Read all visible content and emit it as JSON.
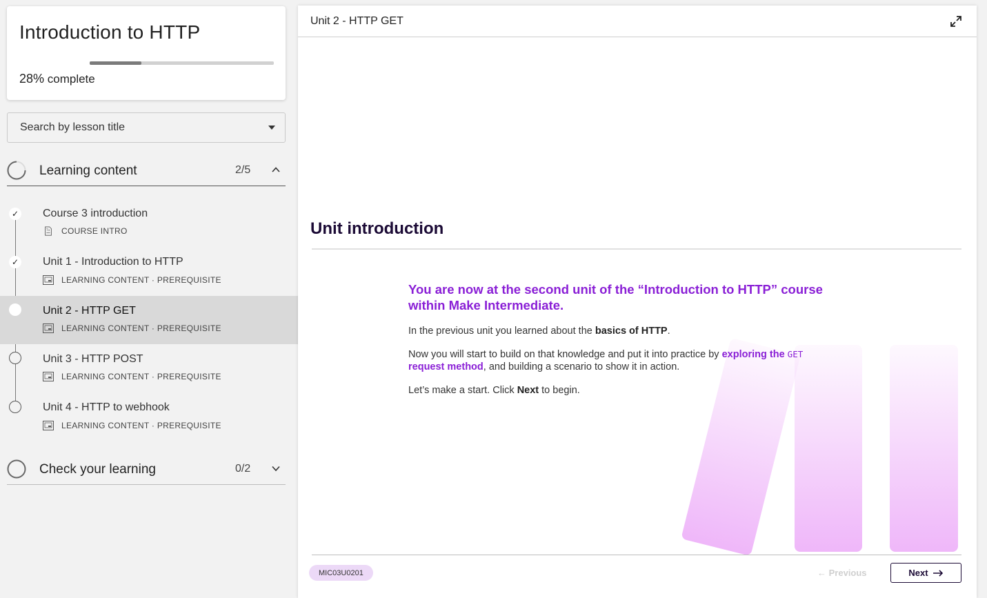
{
  "course": {
    "title": "Introduction to HTTP",
    "progress_percent": 28,
    "progress_value": "28%",
    "progress_suffix": " complete"
  },
  "search": {
    "placeholder": "Search by lesson title"
  },
  "sections": [
    {
      "title": "Learning content",
      "count": "2/5",
      "expanded": true,
      "lessons": [
        {
          "title": "Course 3 introduction",
          "meta": "COURSE INTRO",
          "status": "done",
          "icon": "document-icon"
        },
        {
          "title": "Unit 1 - Introduction to HTTP",
          "meta": "LEARNING CONTENT · PREREQUISITE",
          "status": "done",
          "icon": "slides-icon"
        },
        {
          "title": "Unit 2 - HTTP GET",
          "meta": "LEARNING CONTENT · PREREQUISITE",
          "status": "current",
          "icon": "slides-icon"
        },
        {
          "title": "Unit 3 - HTTP POST",
          "meta": "LEARNING CONTENT · PREREQUISITE",
          "status": "open",
          "icon": "slides-icon"
        },
        {
          "title": "Unit 4 - HTTP to webhook",
          "meta": "LEARNING CONTENT · PREREQUISITE",
          "status": "open",
          "icon": "slides-icon"
        }
      ]
    },
    {
      "title": "Check your learning",
      "count": "0/2",
      "expanded": false
    }
  ],
  "main": {
    "header_title": "Unit 2 - HTTP GET",
    "heading": "Unit introduction",
    "lead": "You are now at the second unit of the “Introduction to HTTP” course within Make Intermediate.",
    "p1_before": "In the previous unit you learned about the ",
    "p1_strong": "basics of HTTP",
    "p1_after": ".",
    "p2_before": "Now you will start to build on that knowledge and put it into practice by ",
    "p2_em1": "exploring the ",
    "p2_code": "GET",
    "p2_em2": "request method",
    "p2_after": ", and building a scenario to show it in action.",
    "p3_before": "Let’s make a start. Click ",
    "p3_strong": "Next",
    "p3_after": " to begin.",
    "badge": "MIC03U0201",
    "prev_label": "Previous",
    "next_label": "Next"
  },
  "colors": {
    "accent": "#8a1fd6",
    "brand_dark": "#1b0a35",
    "badge_bg": "#ecd9f7"
  }
}
